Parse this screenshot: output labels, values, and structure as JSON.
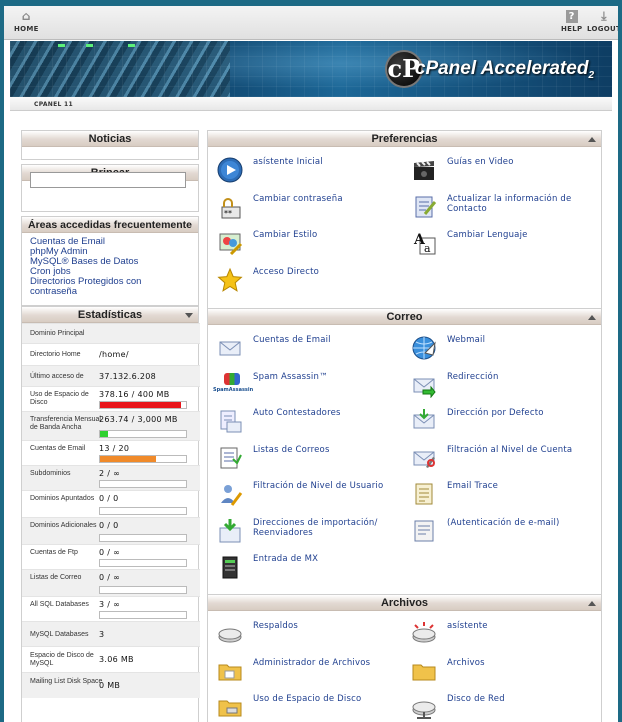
{
  "topnav": {
    "home": "HOME",
    "help": "HELP",
    "logout": "LOGOUT"
  },
  "banner": {
    "logo_text": "cPanel Accelerated",
    "logo_sub": "2"
  },
  "breadcrumb": "CPANEL 11",
  "left": {
    "news": {
      "title": "Noticias"
    },
    "jump": {
      "title": "Brincar",
      "value": ""
    },
    "frequent": {
      "title": "Áreas accedidas frecuentemente",
      "links": [
        "Cuentas de Email",
        "phpMy Admin",
        "MySQL® Bases de Datos",
        "Cron jobs",
        "Directorios Protegidos con contraseña"
      ]
    },
    "stats": {
      "title": "Estadísticas",
      "rows": [
        {
          "label": "Dominio Principal",
          "value": ""
        },
        {
          "label": "Directorio Home",
          "value": "/home/"
        },
        {
          "label": "Último acceso de",
          "value": "37.132.6.208"
        },
        {
          "label": "Uso de Espacio de Disco",
          "value": "378.16 / 400 MB",
          "fraction": 0.945,
          "color": "#e8161b"
        },
        {
          "label": "Transferencia Mensual de Banda Ancha",
          "value": "263.74 / 3,000 MB",
          "fraction": 0.088,
          "color": "#2fd12f"
        },
        {
          "label": "Cuentas de Email",
          "value": "13 / 20",
          "fraction": 0.65,
          "color": "#f08a2a"
        },
        {
          "label": "Subdominios",
          "value": "2 / ∞",
          "fraction": 0,
          "color": "#cccccc"
        },
        {
          "label": "Dominios Apuntados",
          "value": "0 / 0",
          "fraction": 0,
          "color": "#cccccc"
        },
        {
          "label": "Dominios Adicionales",
          "value": "0 / 0",
          "fraction": 0,
          "color": "#cccccc"
        },
        {
          "label": "Cuentas de Ftp",
          "value": "0 / ∞",
          "fraction": 0,
          "color": "#cccccc"
        },
        {
          "label": "Listas de Correo",
          "value": "0 / ∞",
          "fraction": 0,
          "color": "#cccccc"
        },
        {
          "label": "All SQL Databases",
          "value": "3 / ∞",
          "fraction": 0,
          "color": "#cccccc"
        },
        {
          "label": "MySQL Databases",
          "value": "3"
        },
        {
          "label": "Espacio de Disco de MySQL",
          "value": "3.06 MB"
        },
        {
          "label": "Mailing List Disk Space",
          "value": "0 MB"
        }
      ]
    }
  },
  "main": {
    "preferences": {
      "title": "Preferencias",
      "items": [
        {
          "label": "asístente Inicial",
          "icon": "play-icon"
        },
        {
          "label": "Guías en Video",
          "icon": "clapperboard-icon"
        },
        {
          "label": "Cambiar contraseña",
          "icon": "lock-password-icon"
        },
        {
          "label": "Actualizar la información de Contacto",
          "icon": "contact-form-icon"
        },
        {
          "label": "Cambiar Estilo",
          "icon": "palette-icon"
        },
        {
          "label": "Cambiar Lenguaje",
          "icon": "language-icon"
        },
        {
          "label": "Acceso Directo",
          "icon": "star-icon"
        }
      ]
    },
    "mail": {
      "title": "Correo",
      "items": [
        {
          "label": "Cuentas de Email",
          "icon": "envelope-icon"
        },
        {
          "label": "Webmail",
          "icon": "webmail-globe-icon"
        },
        {
          "label": "Spam Assassin™",
          "icon": "spamassassin-icon",
          "icon_text": "SpamAssassin"
        },
        {
          "label": "Redirección",
          "icon": "forward-mail-icon"
        },
        {
          "label": "Auto Contestadores",
          "icon": "autoresponder-icon"
        },
        {
          "label": "Dirección por Defecto",
          "icon": "default-address-icon"
        },
        {
          "label": "Listas de Correos",
          "icon": "mailing-list-icon"
        },
        {
          "label": "Filtración al Nivel de Cuenta",
          "icon": "account-filter-icon"
        },
        {
          "label": "Filtración de Nivel de Usuario",
          "icon": "user-filter-icon"
        },
        {
          "label": "Email Trace",
          "icon": "email-trace-icon"
        },
        {
          "label": "Direcciones de importación/ Reenviadores",
          "icon": "import-addresses-icon"
        },
        {
          "label": "(Autenticación de e-mail)",
          "icon": "email-auth-icon"
        },
        {
          "label": "Entrada de MX",
          "icon": "mx-entry-icon"
        }
      ]
    },
    "files": {
      "title": "Archivos",
      "items": [
        {
          "label": "Respaldos",
          "icon": "backup-drive-icon"
        },
        {
          "label": "asístente",
          "icon": "backup-wizard-icon"
        },
        {
          "label": "Administrador de Archivos",
          "icon": "file-manager-folder-icon"
        },
        {
          "label": "Archivos",
          "icon": "folder-icon"
        },
        {
          "label": "Uso de Espacio de Disco",
          "icon": "disk-usage-icon"
        },
        {
          "label": "Disco de Red",
          "icon": "network-disk-icon"
        }
      ]
    }
  }
}
